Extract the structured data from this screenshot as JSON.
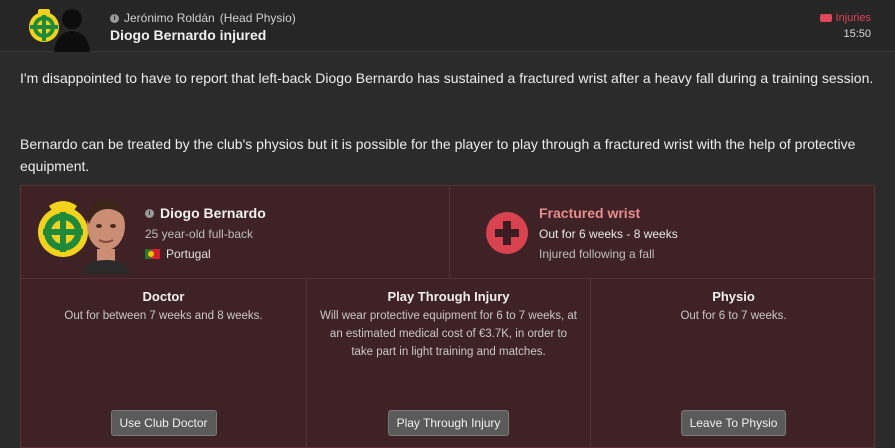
{
  "header": {
    "sender": "Jerónimo Roldán",
    "sender_role": "(Head Physio)",
    "subject": "Diogo Bernardo injured",
    "category": "Injuries",
    "time": "15:50",
    "icons": {
      "category": "bandage-icon",
      "info": "info-icon"
    }
  },
  "message": {
    "paragraph_1": "I'm disappointed to have to report that left-back Diogo Bernardo has sustained a fractured wrist after a heavy fall during a training session.",
    "paragraph_2": "Bernardo can be treated by the club's physios but it is possible for the player to play through a fractured wrist with the help of protective equipment."
  },
  "player": {
    "name": "Diogo Bernardo",
    "description": "25 year-old full-back",
    "nationality": "Portugal"
  },
  "injury": {
    "title": "Fractured wrist",
    "out_for": "Out for 6 weeks - 8 weeks",
    "cause": "Injured following a fall",
    "icon": "medical-cross-icon"
  },
  "options": [
    {
      "title": "Doctor",
      "description": "Out for between 7 weeks and 8 weeks.",
      "button": "Use Club Doctor"
    },
    {
      "title": "Play Through Injury",
      "description": "Will wear protective equipment for 6 to 7 weeks, at an estimated medical cost of €3.7K, in order to take part in light training and matches.",
      "button": "Play Through Injury"
    },
    {
      "title": "Physio",
      "description": "Out for 6 to 7 weeks.",
      "button": "Leave To Physio"
    }
  ],
  "colors": {
    "accent_red": "#e0455a",
    "panel_bg": "#3f2226",
    "injury_title": "#e88d8f"
  }
}
